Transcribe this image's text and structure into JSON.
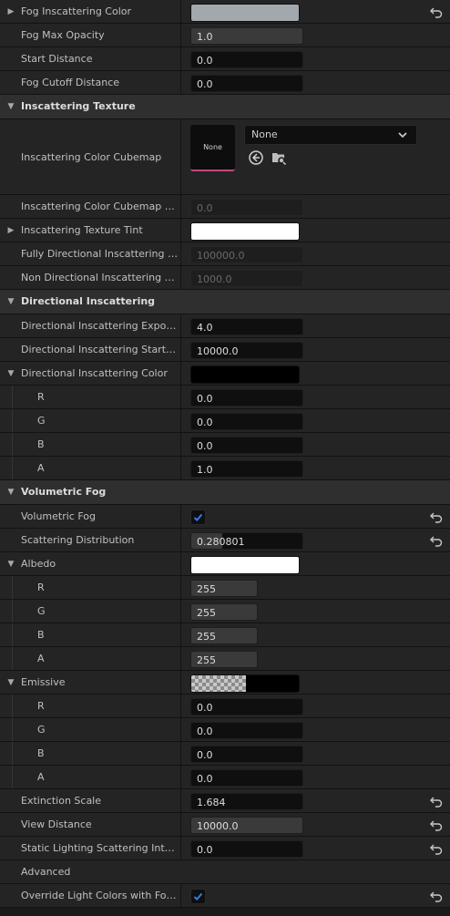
{
  "rows": {
    "fog_inscattering_color": {
      "label": "Fog Inscattering Color"
    },
    "fog_max_opacity": {
      "label": "Fog Max Opacity",
      "value": "1.0"
    },
    "start_distance": {
      "label": "Start Distance",
      "value": "0.0"
    },
    "fog_cutoff_distance": {
      "label": "Fog Cutoff Distance",
      "value": "0.0"
    },
    "sec_inscattering_texture": {
      "label": "Inscattering Texture"
    },
    "inscattering_color_cubemap": {
      "label": "Inscattering Color Cubemap",
      "thumb": "None",
      "asset": "None"
    },
    "cubemap_angle": {
      "label": "Inscattering Color Cubemap Angle",
      "value": "0.0"
    },
    "texture_tint": {
      "label": "Inscattering Texture Tint"
    },
    "fully_directional": {
      "label": "Fully Directional Inscattering Colo...",
      "value": "100000.0"
    },
    "non_directional": {
      "label": "Non Directional Inscattering Colo...",
      "value": "1000.0"
    },
    "sec_directional": {
      "label": "Directional Inscattering"
    },
    "dir_exponent": {
      "label": "Directional Inscattering Exponent",
      "value": "4.0"
    },
    "dir_start_distance": {
      "label": "Directional Inscattering Start Dis...",
      "value": "10000.0"
    },
    "dir_color": {
      "label": "Directional Inscattering Color"
    },
    "dir_r": {
      "label": "R",
      "value": "0.0"
    },
    "dir_g": {
      "label": "G",
      "value": "0.0"
    },
    "dir_b": {
      "label": "B",
      "value": "0.0"
    },
    "dir_a": {
      "label": "A",
      "value": "1.0"
    },
    "sec_volumetric": {
      "label": "Volumetric Fog"
    },
    "volumetric_fog": {
      "label": "Volumetric Fog",
      "checked": true
    },
    "scattering_distribution": {
      "label": "Scattering Distribution",
      "value": "0.280801",
      "fraction": 0.28
    },
    "albedo": {
      "label": "Albedo"
    },
    "alb_r": {
      "label": "R",
      "value": "255"
    },
    "alb_g": {
      "label": "G",
      "value": "255"
    },
    "alb_b": {
      "label": "B",
      "value": "255"
    },
    "alb_a": {
      "label": "A",
      "value": "255"
    },
    "emissive": {
      "label": "Emissive"
    },
    "em_r": {
      "label": "R",
      "value": "0.0"
    },
    "em_g": {
      "label": "G",
      "value": "0.0"
    },
    "em_b": {
      "label": "B",
      "value": "0.0"
    },
    "em_a": {
      "label": "A",
      "value": "0.0"
    },
    "extinction_scale": {
      "label": "Extinction Scale",
      "value": "1.684"
    },
    "view_distance": {
      "label": "View Distance",
      "value": "10000.0"
    },
    "static_lighting": {
      "label": "Static Lighting Scattering Intensi...",
      "value": "0.0"
    },
    "sec_advanced": {
      "label": "Advanced"
    },
    "override_light": {
      "label": "Override Light Colors with Fog In...",
      "checked": true
    }
  },
  "colors": {
    "fog_inscattering_color": "#a2a8ad",
    "texture_tint": "#ffffff",
    "dir_color": "#000000",
    "albedo": "#ffffff",
    "emissive": "#000000",
    "accent": "#2f80ed",
    "cubemap_underline": "#c2487f"
  },
  "icons": [
    "expand-arrow-icon",
    "reset-to-default-icon",
    "checkmark-icon",
    "chevron-down-icon",
    "browse-back-icon",
    "find-in-browser-icon"
  ]
}
